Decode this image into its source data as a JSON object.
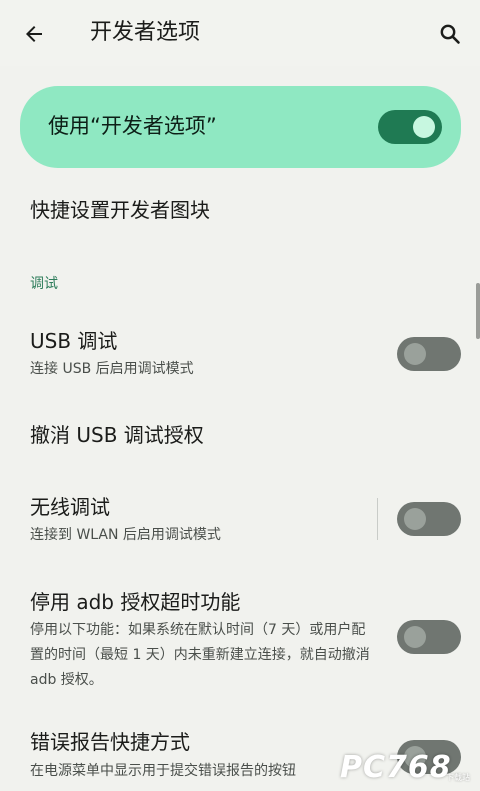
{
  "appbar": {
    "title": "开发者选项",
    "back_icon": "arrow-back-icon",
    "search_icon": "search-icon"
  },
  "master_switch": {
    "label": "使用“开发者选项”",
    "state": "on"
  },
  "quick_tiles": {
    "title": "快捷设置开发者图块"
  },
  "section": {
    "debugging_header": "调试"
  },
  "settings": {
    "usb_debugging": {
      "title": "USB 调试",
      "summary": "连接 USB 后启用调试模式",
      "state": "off"
    },
    "revoke_usb": {
      "title": "撤消 USB 调试授权"
    },
    "wireless_debugging": {
      "title": "无线调试",
      "summary": "连接到 WLAN 后启用调试模式",
      "state": "off"
    },
    "disable_adb_timeout": {
      "title": "停用 adb 授权超时功能",
      "summary": "停用以下功能：如果系统在默认时间（7 天）或用户配置的时间（最短 1 天）内未重新建立连接，就自动撤消 adb 授权。",
      "state": "off"
    },
    "bug_report": {
      "title": "错误报告快捷方式",
      "summary": "在电源菜单中显示用于提交错误报告的按钮",
      "state": "off"
    }
  },
  "watermark": {
    "text": "PC768",
    "sub": "下载站"
  },
  "colors": {
    "background": "#f1f2ee",
    "master_card": "#8fe8c2",
    "switch_on_track": "#1f7a53",
    "switch_off_track": "#707671",
    "section_header": "#2e7d5b"
  }
}
